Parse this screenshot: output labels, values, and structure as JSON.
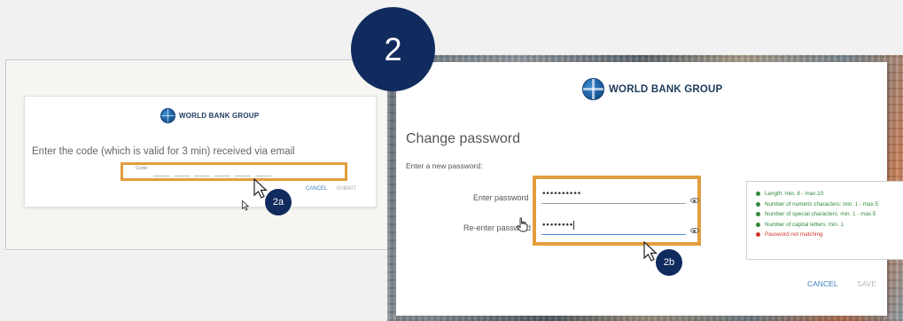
{
  "step": {
    "number": "2",
    "sub_a": "2a",
    "sub_b": "2b"
  },
  "code_screen": {
    "logo_text": "WORLD BANK GROUP",
    "prompt": "Enter the code (which is valid for 3 min) received via email",
    "code_label": "Code:",
    "cancel_label": "CANCEL",
    "submit_label": "SUBMIT"
  },
  "password_screen": {
    "logo_text": "WORLD BANK GROUP",
    "title": "Change password",
    "subtitle": "Enter a new password:",
    "enter_label": "Enter password",
    "reenter_label": "Re-enter password",
    "password_value": "••••••••••",
    "reenter_value": "••••••••",
    "rules": [
      {
        "text": "Length: min. 8 - max.10",
        "status": "ok"
      },
      {
        "text": "Number of numeric characters: min. 1 - max.5",
        "status": "ok"
      },
      {
        "text": "Number of special characters: min. 1 - max.5",
        "status": "ok"
      },
      {
        "text": "Number of capital letters: min. 1",
        "status": "ok"
      },
      {
        "text": "Password not matching",
        "status": "bad"
      }
    ],
    "cancel_label": "CANCEL",
    "save_label": "SAVE"
  },
  "colors": {
    "highlight": "#e39d3d",
    "badge": "#112b5e",
    "link": "#3b7fc4",
    "ok": "#2e8b3a",
    "error": "#d0352c"
  },
  "icons": [
    "globe-logo-icon",
    "eye-icon",
    "arrow-cursor-icon",
    "hand-cursor-icon"
  ]
}
